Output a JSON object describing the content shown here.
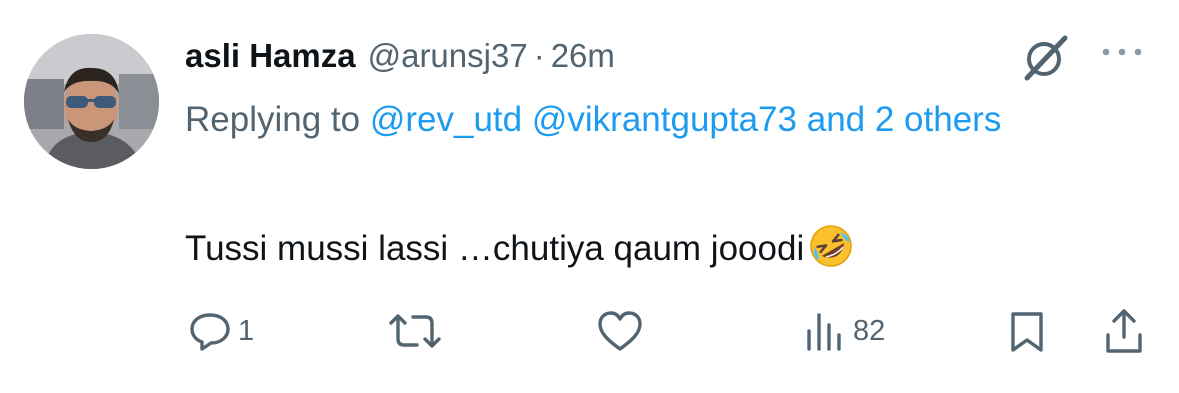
{
  "tweet": {
    "name": "asli Hamza",
    "handle": "@arunsj37",
    "separator": "·",
    "time": "26m",
    "replying_prefix": "Replying to",
    "mention_1": "@rev_utd",
    "mention_2": "@vikrantgupta73",
    "and_others": "and 2 others",
    "text": "Tussi mussi lassi …chutiya qaum jooodi",
    "emoji_icon": "rolling-on-floor-laughing"
  },
  "actions": {
    "reply_count": "1",
    "views_count": "82"
  },
  "colors": {
    "link": "#1d9bf0",
    "secondary": "#536471",
    "primary_text": "#0f1419"
  }
}
